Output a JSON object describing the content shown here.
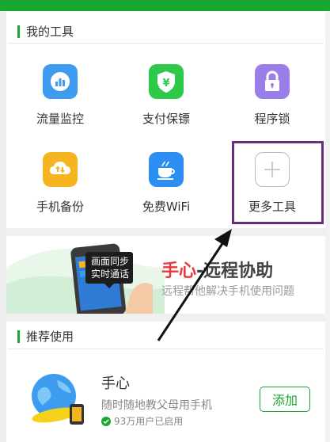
{
  "my_tools": {
    "title": "我的工具",
    "items": [
      {
        "label": "流量监控",
        "icon": "traffic-monitor-icon",
        "color": "#3d9bf0"
      },
      {
        "label": "支付保镖",
        "icon": "payment-guard-icon",
        "color": "#2ec84a"
      },
      {
        "label": "程序锁",
        "icon": "app-lock-icon",
        "color": "#9b7fe8"
      },
      {
        "label": "手机备份",
        "icon": "phone-backup-icon",
        "color": "#f6b420"
      },
      {
        "label": "免费WiFi",
        "icon": "free-wifi-icon",
        "color": "#2c8ef0"
      },
      {
        "label": "更多工具",
        "icon": "plus-icon",
        "color": "#bbbbbb"
      }
    ]
  },
  "banner": {
    "badge_line1": "画面同步",
    "badge_line2": "实时通话",
    "title_highlight": "手心",
    "title_rest": "-远程协助",
    "subtitle": "远程帮他解决手机使用问题"
  },
  "recommended": {
    "title": "推荐使用",
    "app": {
      "name": "手心",
      "description": "随时随地教父母用手机",
      "users": "93万用户已启用",
      "add_label": "添加"
    }
  },
  "colors": {
    "brand_green": "#1aa632",
    "highlight_red": "#e8383d",
    "annotation_purple": "#6b2d7d"
  }
}
